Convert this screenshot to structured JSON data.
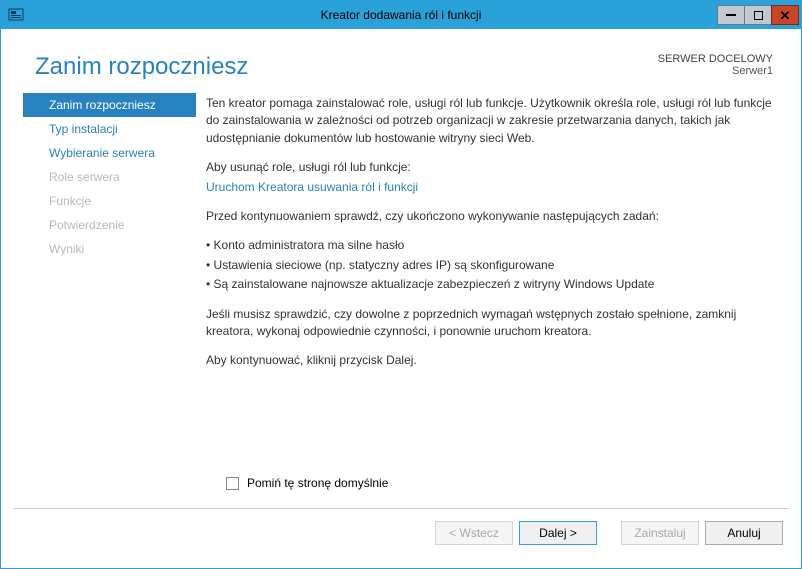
{
  "window": {
    "title": "Kreator dodawania ról i funkcji"
  },
  "header": {
    "title": "Zanim rozpoczniesz",
    "target_label": "SERWER DOCELOWY",
    "target_value": "Serwer1"
  },
  "sidebar": {
    "items": [
      {
        "label": "Zanim rozpoczniesz",
        "state": "selected"
      },
      {
        "label": "Typ instalacji",
        "state": "enabled"
      },
      {
        "label": "Wybieranie serwera",
        "state": "enabled"
      },
      {
        "label": "Role serwera",
        "state": "disabled"
      },
      {
        "label": "Funkcje",
        "state": "disabled"
      },
      {
        "label": "Potwierdzenie",
        "state": "disabled"
      },
      {
        "label": "Wyniki",
        "state": "disabled"
      }
    ]
  },
  "content": {
    "intro": "Ten kreator pomaga zainstalować role, usługi ról lub funkcje. Użytkownik określa role, usługi ról lub funkcje do zainstalowania w zależności od potrzeb organizacji w zakresie przetwarzania danych, takich jak udostępnianie dokumentów lub hostowanie witryny sieci Web.",
    "remove_intro": "Aby usunąć role, usługi ról lub funkcje:",
    "remove_link": "Uruchom Kreatora usuwania ról i funkcji",
    "before_continue": "Przed kontynuowaniem sprawdź, czy ukończono wykonywanie następujących zadań:",
    "checks": [
      "Konto administratora ma silne hasło",
      "Ustawienia sieciowe (np. statyczny adres IP) są skonfigurowane",
      "Są zainstalowane najnowsze aktualizacje zabezpieczeń z witryny Windows Update"
    ],
    "if_check": "Jeśli musisz sprawdzić, czy dowolne z poprzednich wymagań wstępnych zostało spełnione, zamknij kreatora, wykonaj odpowiednie czynności, i ponownie uruchom kreatora.",
    "continue_hint": "Aby kontynuować, kliknij przycisk Dalej.",
    "skip_label": "Pomiń tę stronę domyślnie"
  },
  "footer": {
    "back": "< Wstecz",
    "next": "Dalej >",
    "install": "Zainstaluj",
    "cancel": "Anuluj"
  }
}
